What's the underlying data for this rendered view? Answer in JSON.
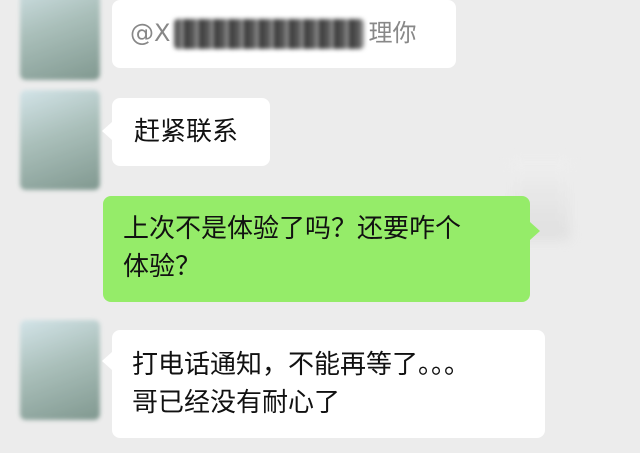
{
  "messages": [
    {
      "side": "left",
      "prefix": "@",
      "name_fragment": "X",
      "suffix": "理你"
    },
    {
      "side": "left",
      "text": "赶紧联系"
    },
    {
      "side": "right",
      "line1": "上次不是体验了吗？还要咋个",
      "line2": "体验？"
    },
    {
      "side": "left",
      "line1": "打电话通知，不能再等了。。。",
      "line2": "哥已经没有耐心了"
    }
  ]
}
